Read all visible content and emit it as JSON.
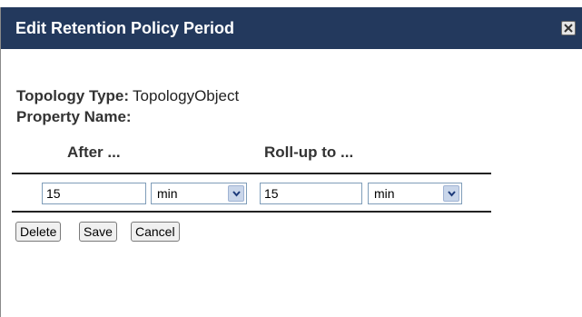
{
  "dialog": {
    "title": "Edit Retention Policy Period"
  },
  "info": {
    "topology_type_label": "Topology Type:",
    "topology_type_value": "TopologyObject",
    "property_name_label": "Property Name:"
  },
  "columns": {
    "after_label": "After ...",
    "rollup_label": "Roll-up to ..."
  },
  "after": {
    "value": "15",
    "unit": "min"
  },
  "rollup": {
    "value": "15",
    "unit": "min"
  },
  "buttons": {
    "delete_label": "Delete",
    "save_label": "Save",
    "cancel_label": "Cancel"
  },
  "icons": {
    "close": "close-icon",
    "dropdown": "chevron-down-icon"
  },
  "colors": {
    "titlebar": "#23395d",
    "title_text": "#ffffff"
  }
}
